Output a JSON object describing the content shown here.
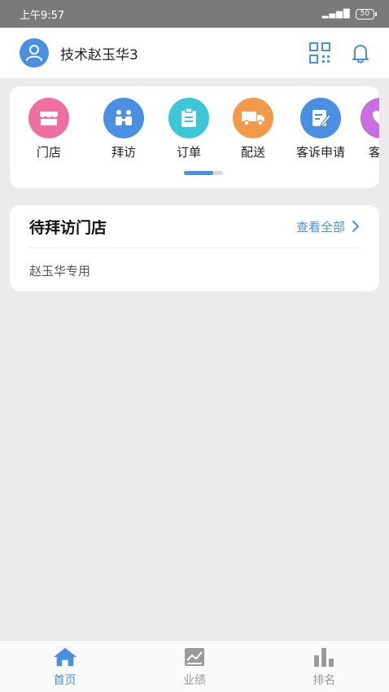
{
  "status_bar": {
    "time": "上午9:57",
    "signal": "4G",
    "battery": "50"
  },
  "header": {
    "user_name": "技术赵玉华3"
  },
  "menu": {
    "items": [
      {
        "label": "门店",
        "color": "#ee6fa0"
      },
      {
        "label": "拜访",
        "color": "#4a90e2"
      },
      {
        "label": "订单",
        "color": "#3cc7d6"
      },
      {
        "label": "配送",
        "color": "#f29a4a"
      },
      {
        "label": "客诉申请",
        "color": "#4a90e2"
      },
      {
        "label": "客户",
        "color": "#c86ee0"
      }
    ]
  },
  "pending_visits": {
    "title": "待拜访门店",
    "view_all": "查看全部",
    "rows": [
      {
        "name": "赵玉华专用"
      }
    ]
  },
  "tab_bar": {
    "tabs": [
      {
        "label": "首页",
        "active": true
      },
      {
        "label": "业绩",
        "active": false
      },
      {
        "label": "排名",
        "active": false
      }
    ],
    "active_color": "#4a90e2",
    "inactive_color": "#999999"
  }
}
